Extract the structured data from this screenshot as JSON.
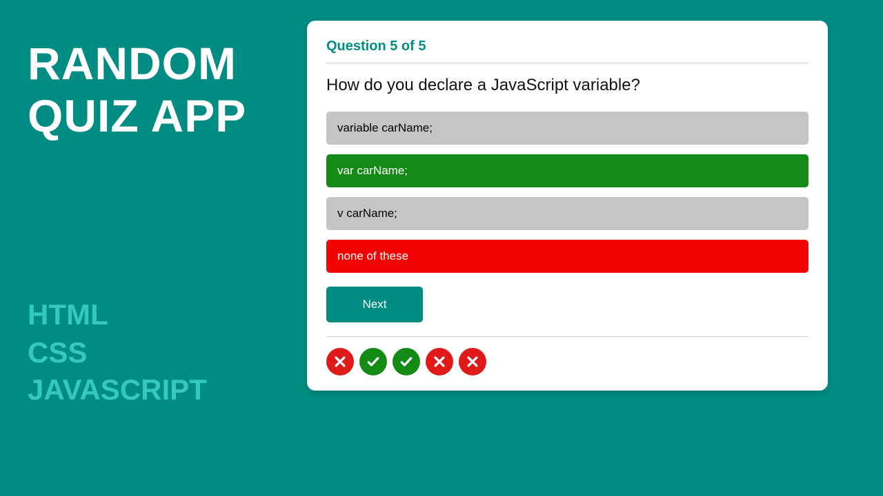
{
  "left": {
    "title_line1": "RANDOM",
    "title_line2": "QUIZ APP",
    "tech_line1": "HTML",
    "tech_line2": "CSS",
    "tech_line3": "JAVASCRIPT"
  },
  "quiz": {
    "progress": "Question 5 of 5",
    "question": "How do you declare a JavaScript variable?",
    "options": [
      {
        "label": "variable carName;",
        "state": "neutral"
      },
      {
        "label": "var carName;",
        "state": "correct"
      },
      {
        "label": "v carName;",
        "state": "neutral"
      },
      {
        "label": "none of these",
        "state": "wrong"
      }
    ],
    "next_label": "Next",
    "history": [
      "bad",
      "ok",
      "ok",
      "bad",
      "bad"
    ]
  },
  "colors": {
    "bg": "#008c82",
    "accent": "#33c9bf",
    "correct": "#138a14",
    "wrong": "#f30404",
    "neutral": "#c5c5c5"
  }
}
